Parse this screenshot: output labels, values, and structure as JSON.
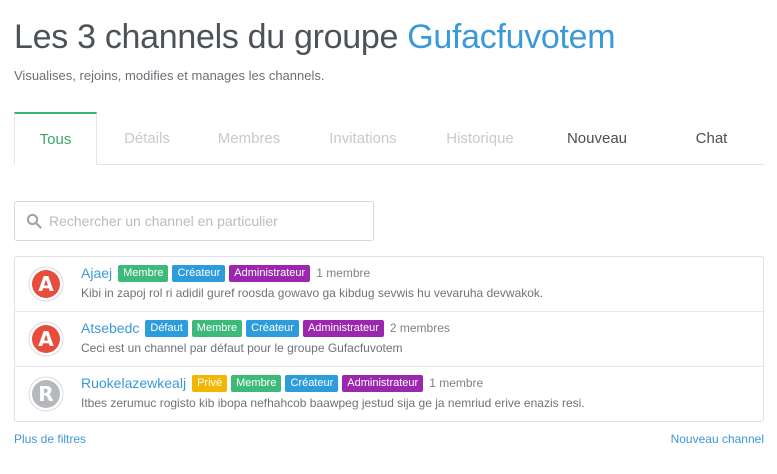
{
  "header": {
    "title_prefix": "Les 3 channels du groupe ",
    "group_name": "Gufacfuvotem",
    "subtitle": "Visualises, rejoins, modifies et manages les channels."
  },
  "tabs": [
    {
      "label": "Tous",
      "state": "active"
    },
    {
      "label": "Détails",
      "state": "disabled"
    },
    {
      "label": "Membres",
      "state": "disabled"
    },
    {
      "label": "Invitations",
      "state": "disabled"
    },
    {
      "label": "Historique",
      "state": "disabled"
    },
    {
      "label": "Nouveau",
      "state": "enabled"
    },
    {
      "label": "Chat",
      "state": "enabled"
    }
  ],
  "search": {
    "placeholder": "Rechercher un channel en particulier",
    "value": ""
  },
  "badge_colors": {
    "Membre": "#3dba7a",
    "Créateur": "#2d9cdb",
    "Administrateur": "#9b27af",
    "Défaut": "#2d9cdb",
    "Privé": "#f2b705"
  },
  "channels": [
    {
      "name": "Ajaej",
      "initial": "A",
      "avatar_color": "#e74c3c",
      "badges": [
        "Membre",
        "Créateur",
        "Administrateur"
      ],
      "members": "1 membre",
      "description": "Kibi in zapoj rol ri adidil guref roosda gowavo ga kibdug sevwis hu vevaruha devwakok."
    },
    {
      "name": "Atsebedc",
      "initial": "A",
      "avatar_color": "#e74c3c",
      "badges": [
        "Défaut",
        "Membre",
        "Créateur",
        "Administrateur"
      ],
      "members": "2 membres",
      "description": "Ceci est un channel par défaut pour le groupe Gufacfuvotem"
    },
    {
      "name": "Ruokelazewkealj",
      "initial": "R",
      "avatar_color": "#b5b8bc",
      "badges": [
        "Privé",
        "Membre",
        "Créateur",
        "Administrateur"
      ],
      "members": "1 membre",
      "description": "Itbes zerumuc rogisto kib ibopa nefhahcob baawpeg jestud sija ge ja nemriud erive enazis resi."
    }
  ],
  "footer": {
    "more_filters": "Plus de filtres",
    "new_channel": "Nouveau channel"
  }
}
